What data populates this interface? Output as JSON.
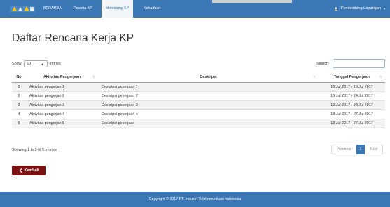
{
  "nav": {
    "items": [
      "BERANDA",
      "Peserta KP",
      "Monitoring KP",
      "Kehadiran"
    ],
    "user": "Pembimbing Lapangan"
  },
  "page": {
    "title": "Daftar Rencana Kerja KP"
  },
  "table_controls": {
    "show_label": "Show",
    "entries_value": "10",
    "entries_label": "entries",
    "search_label": "Search:"
  },
  "table": {
    "headers": [
      "No",
      "Aktivitas Pengerjaan",
      "Deskripsi",
      "Tanggal Pengerjaan"
    ],
    "rows": [
      [
        "1",
        "Aktivitas pengerjan 1",
        "Deskripsi pekerjaan 1",
        "16 Jul 2017 - 19 Jul 2017"
      ],
      [
        "2",
        "Aktivitas pengerjan 2",
        "Deskripsi pekerjaan 2",
        "16 Jul 2017 - 24 Jul 2017"
      ],
      [
        "3",
        "Aktivitas pengerjan 3",
        "Deskripsi pekerjaan 3",
        "16 Jul 2017 - 28 Jul 2017"
      ],
      [
        "4",
        "Aktivitas pengerjan 4",
        "Deskripsi pekerjaan 4",
        "18 Jul 2017 - 27 Jul 2017"
      ],
      [
        "5",
        "Aktivitas pengerjan 5",
        "Deskripsi pekerjaan",
        "18 Jul 2017 - 27 Jul 2017"
      ]
    ],
    "info": "Showing 1 to 5 of 5 entries"
  },
  "pagination": {
    "previous": "Previous",
    "page": "1",
    "next": "Next"
  },
  "back_button": "Kembali",
  "footer": "Copyright © 2017 PT. Industri Telekomunikasi Indonesia",
  "colors": {
    "navbar": "#3b76b5",
    "back_button": "#7a1212",
    "active_page": "#3b76b5"
  },
  "icons": {
    "user": "user-icon",
    "back": "chevron-left-icon",
    "sort": "sort-icon",
    "dropdown": "caret-down-icon"
  }
}
